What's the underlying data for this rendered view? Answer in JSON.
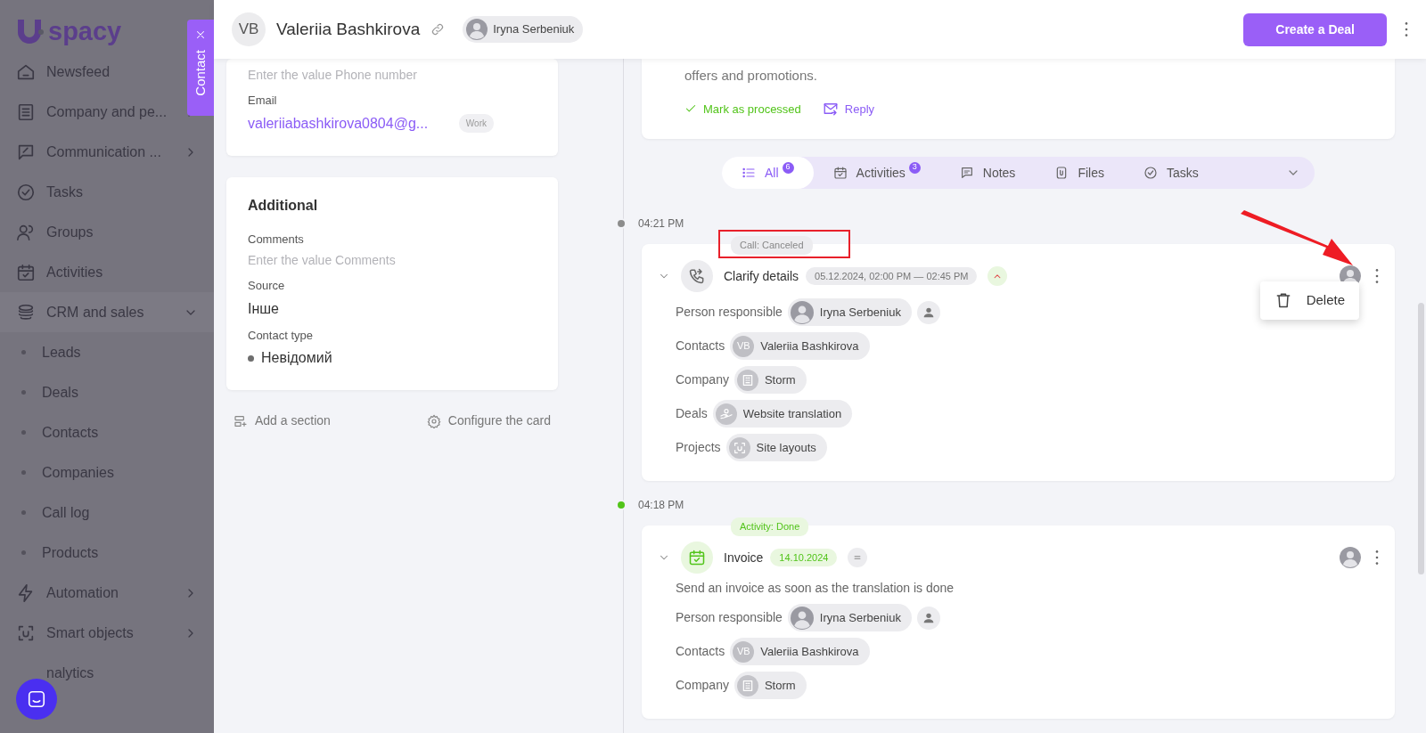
{
  "sidebar": {
    "logo": "spacy",
    "items": [
      {
        "label": "Newsfeed"
      },
      {
        "label": "Company and pe...",
        "expanded": false
      },
      {
        "label": "Communication ...",
        "expanded": false
      },
      {
        "label": "Tasks"
      },
      {
        "label": "Groups"
      },
      {
        "label": "Activities"
      },
      {
        "label": "CRM and sales",
        "expanded": true,
        "children": [
          {
            "label": "Leads"
          },
          {
            "label": "Deals"
          },
          {
            "label": "Contacts"
          },
          {
            "label": "Companies"
          },
          {
            "label": "Call log"
          },
          {
            "label": "Products"
          }
        ]
      },
      {
        "label": "Automation",
        "expanded": false
      },
      {
        "label": "Smart objects",
        "expanded": false
      },
      {
        "label": "nalytics"
      }
    ]
  },
  "contact_tab": {
    "label": "Contact"
  },
  "header": {
    "initials": "VB",
    "name": "Valeriia Bashkirova",
    "responsible": "Iryna Serbeniuk",
    "action": "Create a Deal"
  },
  "contact_card": {
    "fields": [
      {
        "placeholder": "Enter the value Phone number"
      },
      {
        "label": "Email",
        "value": "valeriiabashkirova0804@g...",
        "tag": "Work"
      }
    ]
  },
  "additional": {
    "title": "Additional",
    "fields": [
      {
        "label": "Comments",
        "placeholder": "Enter the value Comments"
      },
      {
        "label": "Source",
        "value": "Інше"
      },
      {
        "label": "Contact type",
        "value": "Невідомий",
        "color": "#6e6e6e"
      }
    ]
  },
  "card_actions": [
    "Add a section",
    "Configure the card"
  ],
  "message": {
    "text": "offers and promotions.",
    "actions": [
      {
        "label": "Mark as processed",
        "kind": "done"
      },
      {
        "label": "Reply",
        "kind": "reply"
      }
    ]
  },
  "filter_tabs": [
    {
      "label": "All",
      "count": "6",
      "selected": true
    },
    {
      "label": "Activities",
      "count": "3",
      "selected": false
    },
    {
      "label": "Notes",
      "selected": false
    },
    {
      "label": "Files",
      "selected": false
    },
    {
      "label": "Tasks",
      "selected": false
    }
  ],
  "events": [
    {
      "time": "04:21 PM",
      "color": "#8c8c8c",
      "kind": "call",
      "status": "Call: Canceled",
      "title": "Clarify details",
      "date": "05.12.2024, 02:00 PM — 02:45 PM",
      "urgent": true,
      "menu": [
        "Delete"
      ],
      "fields": [
        {
          "label": "Person responsible",
          "kind": "person",
          "value": "Iryna Serbeniuk"
        },
        {
          "label": "Contacts",
          "kind": "contact",
          "initials": "VB",
          "value": "Valeriia Bashkirova"
        },
        {
          "label": "Company",
          "kind": "company",
          "value": "Storm"
        },
        {
          "label": "Deals",
          "kind": "deal",
          "value": "Website translation"
        },
        {
          "label": "Projects",
          "kind": "project",
          "value": "Site layouts"
        }
      ]
    },
    {
      "time": "04:18 PM",
      "color": "#52c41a",
      "kind": "activity",
      "status": "Activity: Done",
      "title": "Invoice",
      "date": "14.10.2024",
      "urgent": false,
      "description": "Send an invoice as soon as the translation is done",
      "fields": [
        {
          "label": "Person responsible",
          "kind": "person",
          "value": "Iryna Serbeniuk"
        },
        {
          "label": "Contacts",
          "kind": "contact",
          "initials": "VB",
          "value": "Valeriia Bashkirova"
        },
        {
          "label": "Company",
          "kind": "company",
          "value": "Storm"
        }
      ]
    }
  ]
}
